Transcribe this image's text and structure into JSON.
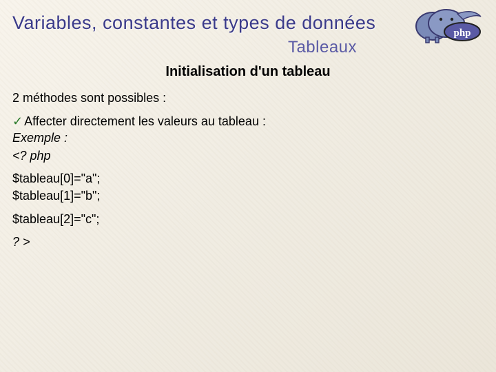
{
  "title": "Variables, constantes et types de données",
  "subtitle": "Tableaux",
  "section_heading": "Initialisation d'un tableau",
  "intro": "2 méthodes sont possibles :",
  "bullet": {
    "check": "✓",
    "text": "Affecter directement les valeurs au tableau :"
  },
  "example_label": "Exemple :",
  "code_open": "<? php",
  "code_lines": {
    "l1": "$tableau[0]=\"a\";",
    "l2": "$tableau[1]=\"b\";",
    "l3": "$tableau[2]=\"c\";"
  },
  "code_close": "? >",
  "logo": {
    "name": "php-logo",
    "text": "php"
  }
}
